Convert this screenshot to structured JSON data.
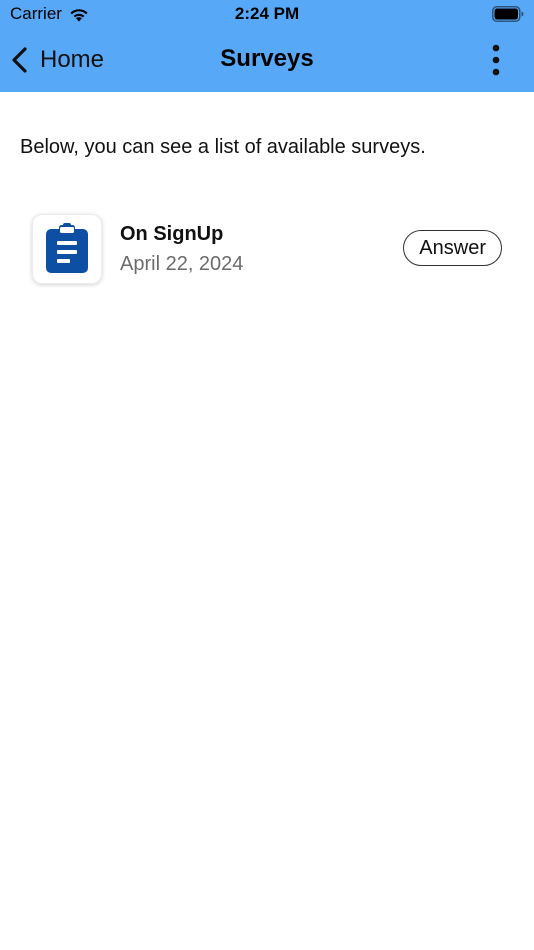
{
  "status_bar": {
    "carrier": "Carrier",
    "time": "2:24 PM"
  },
  "nav": {
    "back_label": "Home",
    "title": "Surveys",
    "background_color": "#58a8f8"
  },
  "intro_text": "Below, you can see a list of available surveys.",
  "surveys": [
    {
      "title": "On SignUp",
      "date": "April 22, 2024",
      "action_label": "Answer",
      "icon": "clipboard-icon",
      "icon_color": "#0d4fa3"
    }
  ]
}
